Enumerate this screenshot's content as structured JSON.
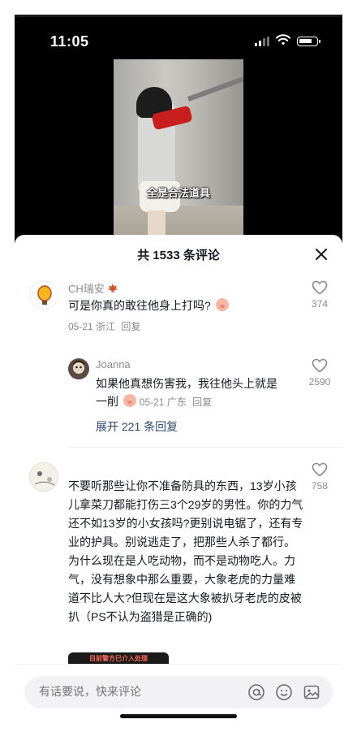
{
  "status_bar": {
    "time": "11:05"
  },
  "video": {
    "caption": "全是合法道具"
  },
  "comments_sheet": {
    "title": "共 1533 条评论",
    "comments": [
      {
        "username": "CH瑞安",
        "text": "可是你真的敢往他身上打吗?",
        "date_location": "05-21 浙江",
        "reply_label": "回复",
        "likes": "374",
        "icon": "pig-face-emoji"
      }
    ],
    "reply": {
      "username": "Joanna",
      "text_line1": "如果他真想伤害我，我往他头上就是",
      "text_line2": "一削",
      "date_location": "05-21 广东",
      "reply_label": "回复",
      "likes": "2590"
    },
    "expand_replies": "展开 221 条回复",
    "long_comment": {
      "text": "不要听那些让你不准备防具的东西，13岁小孩儿拿菜刀都能打伤三3个29岁的男性。你的力气还不如13岁的小女孩吗?更别说电锯了，还有专业的护具。别说逃走了，把那些人杀了都行。为什么现在是人吃动物，而不是动物吃人。力气，没有想象中那么重要，大象老虎的力量难道不比人大?但现在是这大象被扒牙老虎的皮被扒（PS不认为盗猎是正确的)",
      "likes": "758",
      "image_caption": "目前警方已介入处理"
    }
  },
  "input_bar": {
    "placeholder": "有话要说，快来评论",
    "icons": [
      "at-icon",
      "emoji-icon",
      "image-icon"
    ]
  },
  "colors": {
    "link": "#2b4b76",
    "muted": "#8a8b91",
    "text": "#161823"
  }
}
